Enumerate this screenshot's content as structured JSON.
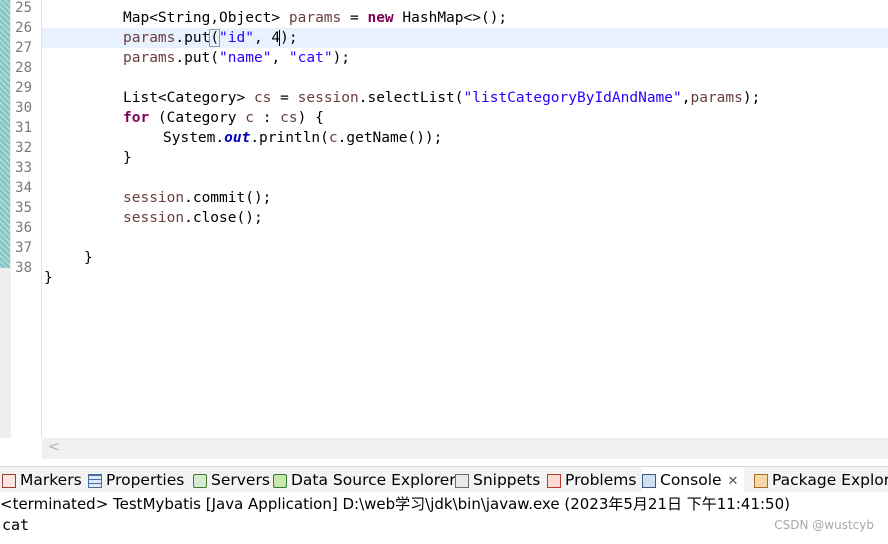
{
  "editor": {
    "line_numbers": [
      "25",
      "26",
      "27",
      "28",
      "29",
      "30",
      "31",
      "32",
      "33",
      "34",
      "35",
      "36",
      "37",
      "38"
    ],
    "line25": [
      "Map<String,Object> ",
      "params",
      " = ",
      "new",
      " HashMap<>();"
    ],
    "line26": [
      "params",
      ".put",
      "(",
      "\"id\"",
      ", 4",
      ");"
    ],
    "line27": [
      "params",
      ".put(",
      "\"name\"",
      ", ",
      "\"cat\"",
      ");"
    ],
    "line29": [
      "List<Category> ",
      "cs",
      " = ",
      "session",
      ".selectList(",
      "\"listCategoryByIdAndName\"",
      ",",
      "params",
      ");"
    ],
    "line30": [
      "for",
      " (Category ",
      "c",
      " : ",
      "cs",
      ") {"
    ],
    "line31": [
      "System.",
      "out",
      ".println(",
      "c",
      ".getName());"
    ],
    "line32": "}",
    "line34": [
      "session",
      ".commit();"
    ],
    "line35": [
      "session",
      ".close();"
    ],
    "line37": "}",
    "line38": "}"
  },
  "tabs": {
    "markers": "Markers",
    "properties": "Properties",
    "servers": "Servers",
    "datasource": "Data Source Explorer",
    "snippets": "Snippets",
    "problems": "Problems",
    "console": "Console",
    "console_close": "✕",
    "package": "Package Explore"
  },
  "console": {
    "status": "<terminated> TestMybatis [Java Application] D:\\web学习\\jdk\\bin\\javaw.exe (2023年5月21日 下午11:41:50)",
    "output": "cat"
  },
  "watermark": "CSDN @wustcyb",
  "colors": {
    "keyword": "#7f0055",
    "string": "#2a00ff",
    "variable": "#6a3e3e",
    "static_field": "#0000c0",
    "line_number": "#787878",
    "current_line": "#e8f2fe"
  }
}
